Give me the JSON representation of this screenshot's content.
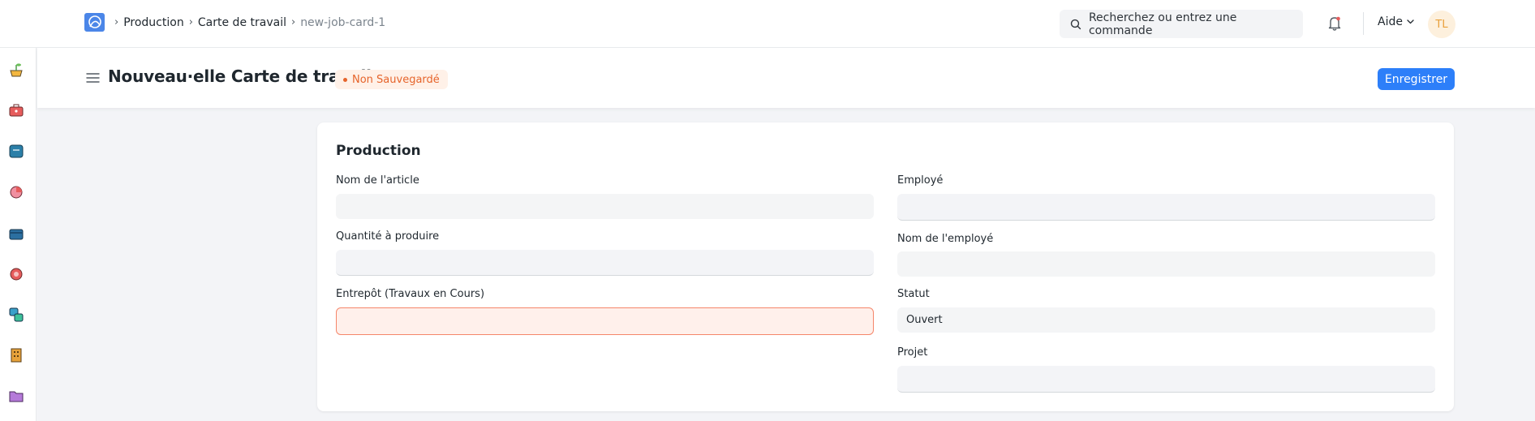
{
  "navbar": {
    "breadcrumbs": [
      "Production",
      "Carte de travail"
    ],
    "current_doc": "new-job-card-1",
    "search_placeholder": "Recherchez ou entrez une commande",
    "help_label": "Aide",
    "avatar_initials": "TL"
  },
  "page": {
    "title": "Nouveau·elle Carte de travail",
    "status_badge": "Non Sauvegardé",
    "save_label": "Enregistrer"
  },
  "form": {
    "section_title": "Production",
    "item_name": {
      "label": "Nom de l'article",
      "value": ""
    },
    "qty_to_produce": {
      "label": "Quantité à produire",
      "value": ""
    },
    "wip_warehouse": {
      "label": "Entrepôt (Travaux en Cours)",
      "value": ""
    },
    "employee": {
      "label": "Employé",
      "value": ""
    },
    "employee_name": {
      "label": "Nom de l'employé",
      "value": ""
    },
    "status": {
      "label": "Statut",
      "value": "Ouvert"
    },
    "project": {
      "label": "Projet",
      "value": ""
    }
  },
  "sidebar": {
    "icons": [
      "plant-pot-icon",
      "toolbox-icon",
      "accounting-icon",
      "pie-chart-icon",
      "wallet-icon",
      "support-icon",
      "stock-icon",
      "building-icon",
      "folder-icon"
    ]
  },
  "colors": {
    "primary": "#2d7ff9",
    "unsaved": "#e6642b",
    "error_border": "#f5866a"
  }
}
